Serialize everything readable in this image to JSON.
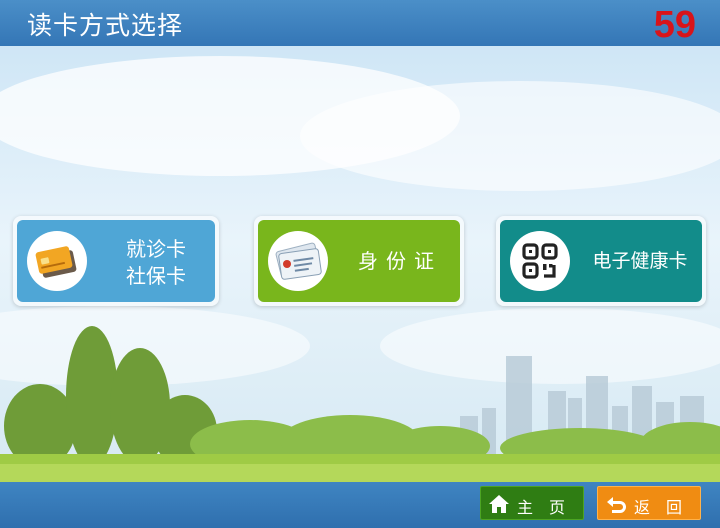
{
  "header": {
    "title": "读卡方式选择",
    "countdown": "59"
  },
  "cards": {
    "medical": {
      "line1": "就诊卡",
      "line2": "社保卡",
      "color": "#4fa6d6"
    },
    "id": {
      "label": "身份证",
      "color": "#79b61c"
    },
    "health": {
      "label": "电子健康卡",
      "color": "#128c8a"
    }
  },
  "footer": {
    "home_label": "主页",
    "back_label": "返回",
    "home_icon": "home-icon",
    "back_icon": "return-arrow-icon"
  }
}
